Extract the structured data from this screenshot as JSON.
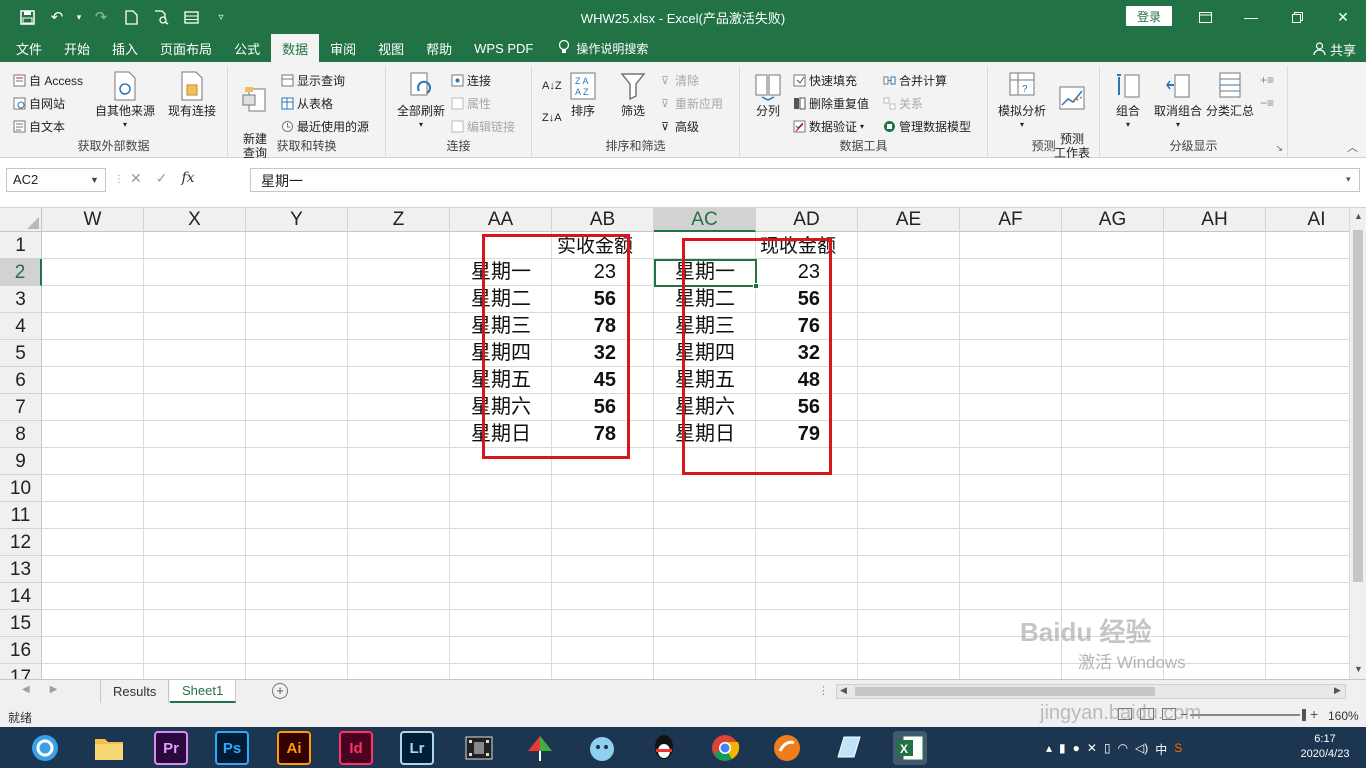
{
  "window": {
    "title": "WHW25.xlsx  -  Excel(产品激活失败)",
    "login_label": "登录",
    "share_label": "共享"
  },
  "tabs": [
    "文件",
    "开始",
    "插入",
    "页面布局",
    "公式",
    "数据",
    "审阅",
    "视图",
    "帮助",
    "WPS PDF"
  ],
  "active_tab": "数据",
  "tell_me": "操作说明搜索",
  "ribbon": {
    "get_external": {
      "label": "获取外部数据",
      "access": "自 Access",
      "web": "自网站",
      "text": "自文本",
      "other_sources": "自其他来源",
      "existing": "现有连接"
    },
    "get_transform": {
      "label": "获取和转换",
      "new_query": "新建\n查询",
      "show_queries": "显示查询",
      "from_table": "从表格",
      "recent_sources": "最近使用的源"
    },
    "connections": {
      "label": "连接",
      "refresh_all": "全部刷新",
      "connections": "连接",
      "properties": "属性",
      "edit_links": "编辑链接"
    },
    "sort_filter": {
      "label": "排序和筛选",
      "sort": "排序",
      "filter": "筛选",
      "clear": "清除",
      "reapply": "重新应用",
      "advanced": "高级"
    },
    "data_tools": {
      "label": "数据工具",
      "text_to_columns": "分列",
      "flash_fill": "快速填充",
      "remove_duplicates": "删除重复值",
      "data_validation": "数据验证",
      "consolidate": "合并计算",
      "relationships": "关系",
      "manage_model": "管理数据模型"
    },
    "forecast": {
      "label": "预测",
      "what_if": "模拟分析",
      "forecast_sheet": "预测\n工作表"
    },
    "outline": {
      "label": "分级显示",
      "group": "组合",
      "ungroup": "取消组合",
      "subtotal": "分类汇总"
    }
  },
  "formula_bar": {
    "name_box": "AC2",
    "content": "星期一"
  },
  "columns": [
    "W",
    "X",
    "Y",
    "Z",
    "AA",
    "AB",
    "AC",
    "AD",
    "AE",
    "AF",
    "AG",
    "AH",
    "AI"
  ],
  "selected_column": "AC",
  "rows": [
    "1",
    "2",
    "3",
    "4",
    "5",
    "6",
    "7",
    "8",
    "9",
    "10",
    "11",
    "12",
    "13",
    "14",
    "15",
    "16",
    "17"
  ],
  "selected_row": "2",
  "table1": {
    "header": "实收金额",
    "days": [
      "星期一",
      "星期二",
      "星期三",
      "星期四",
      "星期五",
      "星期六",
      "星期日"
    ],
    "values": [
      "23",
      "56",
      "78",
      "32",
      "45",
      "56",
      "78"
    ]
  },
  "table2": {
    "header": "现收金额",
    "days": [
      "星期一",
      "星期二",
      "星期三",
      "星期四",
      "星期五",
      "星期六",
      "星期日"
    ],
    "values": [
      "23",
      "56",
      "76",
      "32",
      "48",
      "56",
      "79"
    ]
  },
  "sheets": [
    "Results",
    "Sheet1"
  ],
  "active_sheet": "Sheet1",
  "status": {
    "ready": "就绪",
    "zoom": "160%"
  },
  "taskbar": {
    "apps": [
      "Pr",
      "Ps",
      "Ai",
      "Id",
      "Lr"
    ],
    "clock_time": "6:17",
    "clock_date": "2020/4/23",
    "ime": "中"
  },
  "watermark": {
    "activate": "激活 Windows",
    "brand": "Baidu 经验",
    "url": "jingyan.baidu.com"
  },
  "colors": {
    "excel_green": "#217346",
    "red_box": "#d9141a",
    "taskbar": "#1c3550"
  }
}
